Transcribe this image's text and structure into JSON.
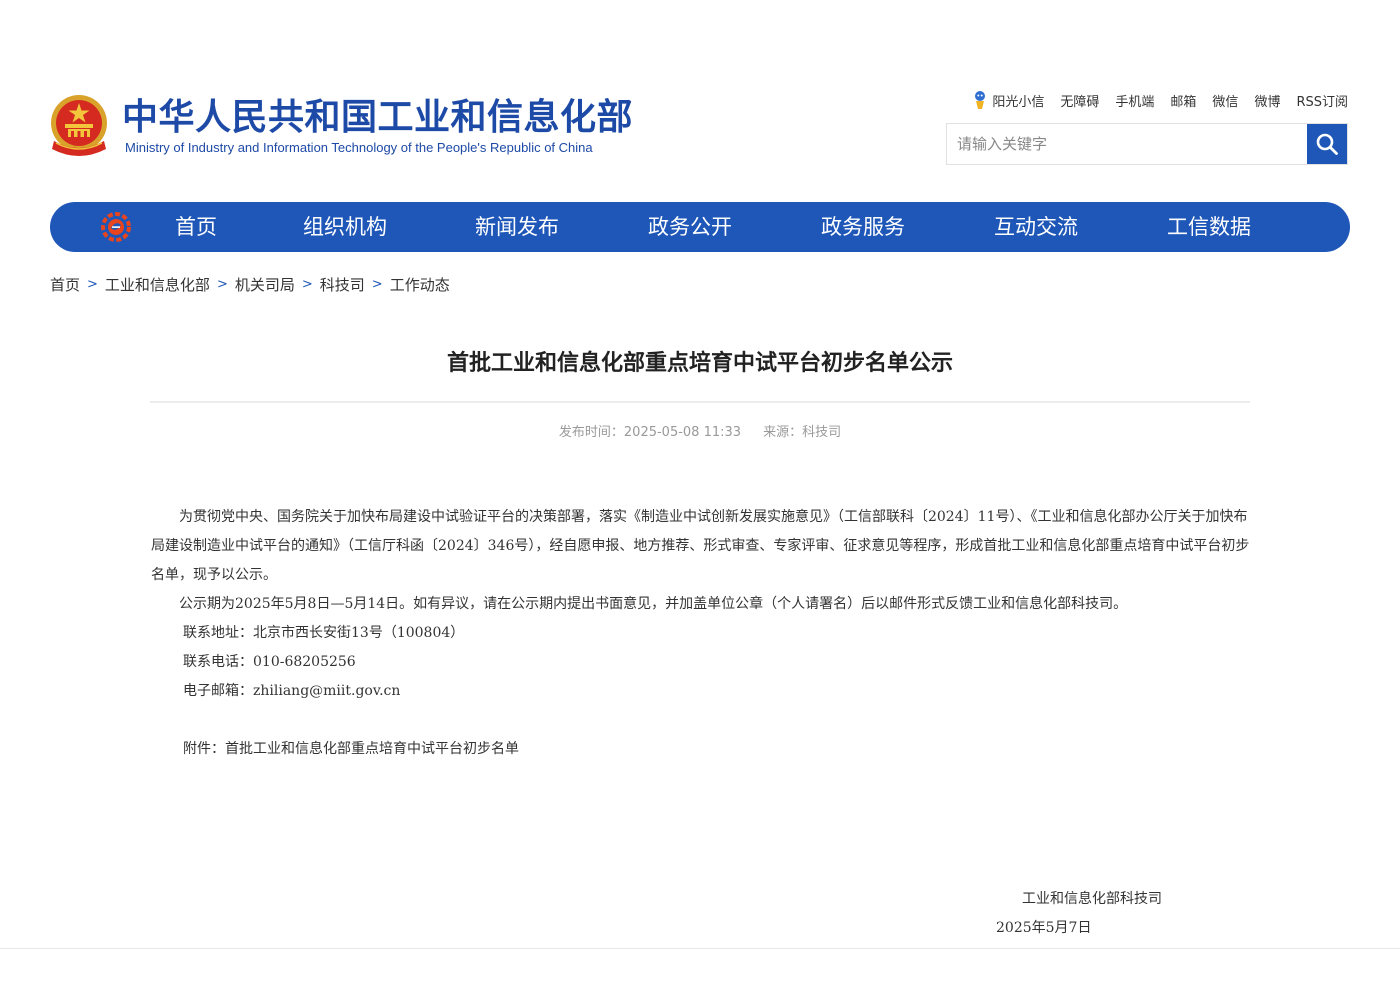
{
  "header": {
    "title": "中华人民共和国工业和信息化部",
    "subtitle": "Ministry of Industry and Information Technology of the People's Republic of China",
    "top_links": [
      "阳光小信",
      "无障碍",
      "手机端",
      "邮箱",
      "微信",
      "微博",
      "RSS订阅"
    ],
    "search_placeholder": "请输入关键字",
    "brand_color": "#1e57b8"
  },
  "nav": {
    "items": [
      "首页",
      "组织机构",
      "新闻发布",
      "政务公开",
      "政务服务",
      "互动交流",
      "工信数据"
    ]
  },
  "breadcrumb": [
    "首页",
    "工业和信息化部",
    "机关司局",
    "科技司",
    "工作动态"
  ],
  "article": {
    "title": "首批工业和信息化部重点培育中试平台初步名单公示",
    "publish_time_label": "发布时间：",
    "publish_time": "2025-05-08 11:33",
    "source_label": "来源：",
    "source": "科技司",
    "paragraphs": [
      "为贯彻党中央、国务院关于加快布局建设中试验证平台的决策部署，落实《制造业中试创新发展实施意见》（工信部联科〔2024〕11号）、《工业和信息化部办公厅关于加快布局建设制造业中试平台的通知》（工信厅科函〔2024〕346号），经自愿申报、地方推荐、形式审查、专家评审、征求意见等程序，形成首批工业和信息化部重点培育中试平台初步名单，现予以公示。",
      "公示期为2025年5月8日—5月14日。如有异议，请在公示期内提出书面意见，并加盖单位公章（个人请署名）后以邮件形式反馈工业和信息化部科技司。"
    ],
    "contact_address": "联系地址：北京市西长安街13号（100804）",
    "contact_phone": "联系电话：010-68205256",
    "contact_email": "电子邮箱：zhiliang@miit.gov.cn",
    "attachment": "附件：首批工业和信息化部重点培育中试平台初步名单",
    "signature_org": "工业和信息化部科技司",
    "signature_date": "2025年5月7日"
  }
}
